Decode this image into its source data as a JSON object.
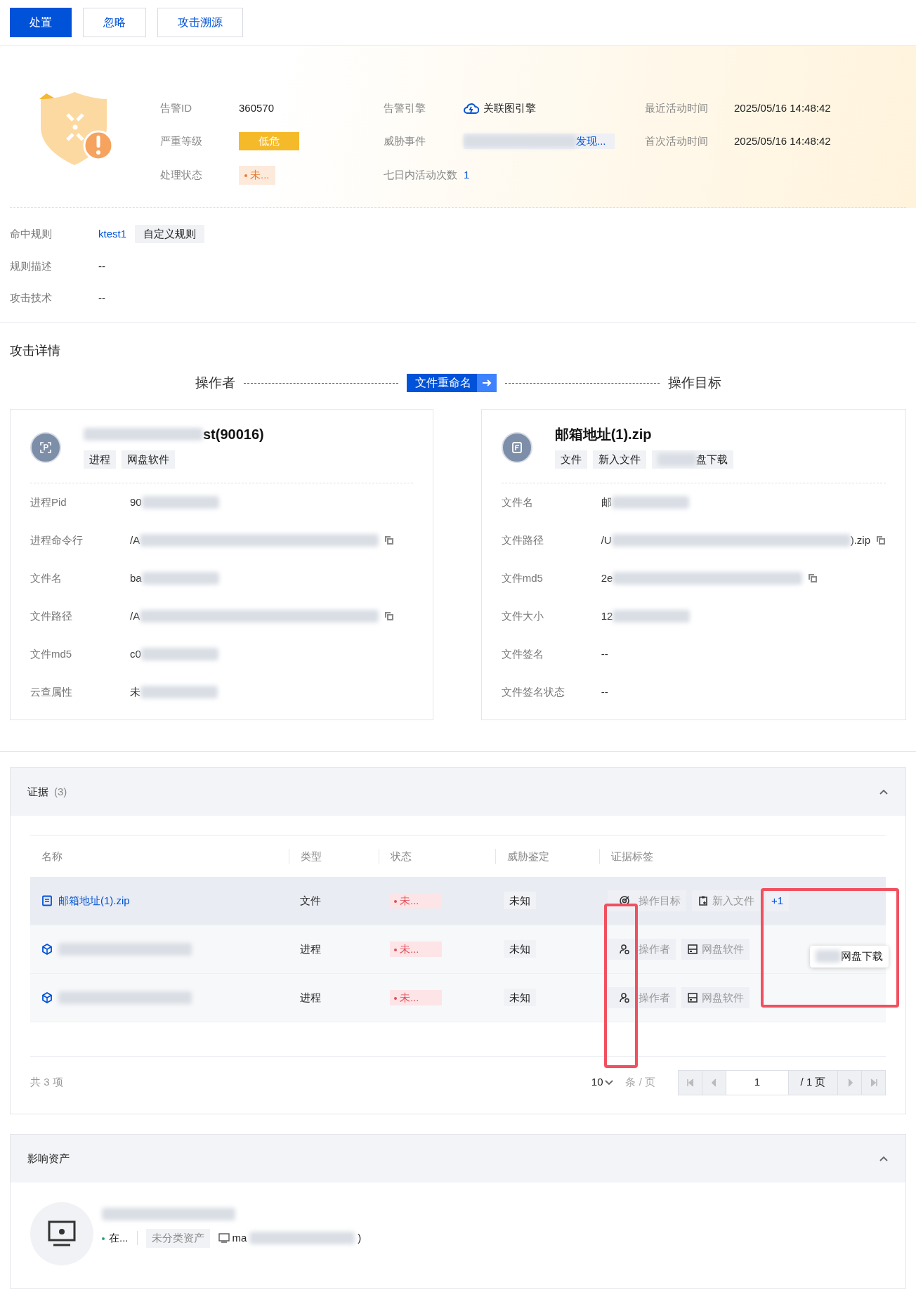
{
  "toolbar": {
    "buttons": [
      {
        "label": "处置",
        "primary": true
      },
      {
        "label": "忽略",
        "primary": false
      },
      {
        "label": "攻击溯源",
        "primary": false
      }
    ]
  },
  "alert": {
    "fields": [
      {
        "label": "告警ID",
        "value": "360570",
        "kind": "text"
      },
      {
        "label": "告警引擎",
        "value": "关联图引擎",
        "kind": "engine"
      },
      {
        "label": "最近活动时间",
        "value": "2025/05/16 14:48:42",
        "kind": "text"
      },
      {
        "label": "严重等级",
        "value": "低危",
        "kind": "severity"
      },
      {
        "label": "威胁事件",
        "value": "发现...",
        "kind": "blurlink"
      },
      {
        "label": "首次活动时间",
        "value": "2025/05/16 14:48:42",
        "kind": "text"
      },
      {
        "label": "处理状态",
        "value": "未...",
        "kind": "status"
      },
      {
        "label": "七日内活动次数",
        "value": "1",
        "kind": "link"
      }
    ]
  },
  "rule": {
    "rows": [
      {
        "label": "命中规则",
        "value": "ktest1",
        "tag": "自定义规则"
      },
      {
        "label": "规则描述",
        "value": "--"
      },
      {
        "label": "攻击技术",
        "value": "--"
      }
    ]
  },
  "attack": {
    "title": "攻击详情",
    "actor_label": "操作者",
    "action": "文件重命名",
    "target_label": "操作目标",
    "cards": [
      {
        "kind": "process",
        "title": "st(90016)",
        "tags": [
          "进程",
          "网盘软件"
        ],
        "rows": [
          {
            "label": "进程Pid",
            "value": "90",
            "copy": false
          },
          {
            "label": "进程命令行",
            "value": "/A",
            "copy": true
          },
          {
            "label": "文件名",
            "value": "ba",
            "copy": false
          },
          {
            "label": "文件路径",
            "value": "/A",
            "copy": true
          },
          {
            "label": "文件md5",
            "value": "c0",
            "copy": false
          },
          {
            "label": "云查属性",
            "value": "未",
            "copy": false
          }
        ]
      },
      {
        "kind": "file",
        "title": "邮箱地址(1).zip",
        "tags": [
          "文件",
          "新入文件",
          "盘下载"
        ],
        "rows": [
          {
            "label": "文件名",
            "value": "邮",
            "copy": false
          },
          {
            "label": "文件路径",
            "value": "/U",
            "suffix": ").zip",
            "copy": true
          },
          {
            "label": "文件md5",
            "value": "2e",
            "copy": true
          },
          {
            "label": "文件大小",
            "value": "12",
            "copy": false
          },
          {
            "label": "文件签名",
            "value": "--",
            "copy": false
          },
          {
            "label": "文件签名状态",
            "value": "--",
            "copy": false
          }
        ]
      }
    ]
  },
  "evidence": {
    "title": "证据",
    "count": "(3)",
    "expanded": true,
    "columns": [
      "名称",
      "类型",
      "状态",
      "威胁鉴定",
      "证据标签"
    ],
    "rows": [
      {
        "kind": "file",
        "name": "邮箱地址(1).zip",
        "type": "文件",
        "status": "未...",
        "verdict": "未知",
        "selected": true,
        "tags": [
          {
            "kind": "target",
            "label": "操作目标"
          },
          {
            "kind": "newfile",
            "label": "新入文件"
          },
          {
            "kind": "more",
            "label": "+1"
          }
        ]
      },
      {
        "kind": "process",
        "name": "",
        "type": "进程",
        "status": "未...",
        "verdict": "未知",
        "selected": false,
        "tags": [
          {
            "kind": "actor",
            "label": "操作者"
          },
          {
            "kind": "software",
            "label": "网盘软件"
          }
        ]
      },
      {
        "kind": "process",
        "name": "",
        "type": "进程",
        "status": "未...",
        "verdict": "未知",
        "selected": false,
        "tags": [
          {
            "kind": "actor",
            "label": "操作者"
          },
          {
            "kind": "software",
            "label": "网盘软件"
          }
        ]
      }
    ],
    "tooltip": "网盘下载",
    "total": "共 3 项",
    "page_size": "10",
    "per_page": "条 / 页",
    "page": "1",
    "page_total": "/ 1 页"
  },
  "assets": {
    "title": "影响资产",
    "expanded": true,
    "status": "在...",
    "category": "未分类资产",
    "host": "ma",
    "host_suffix": ")"
  }
}
